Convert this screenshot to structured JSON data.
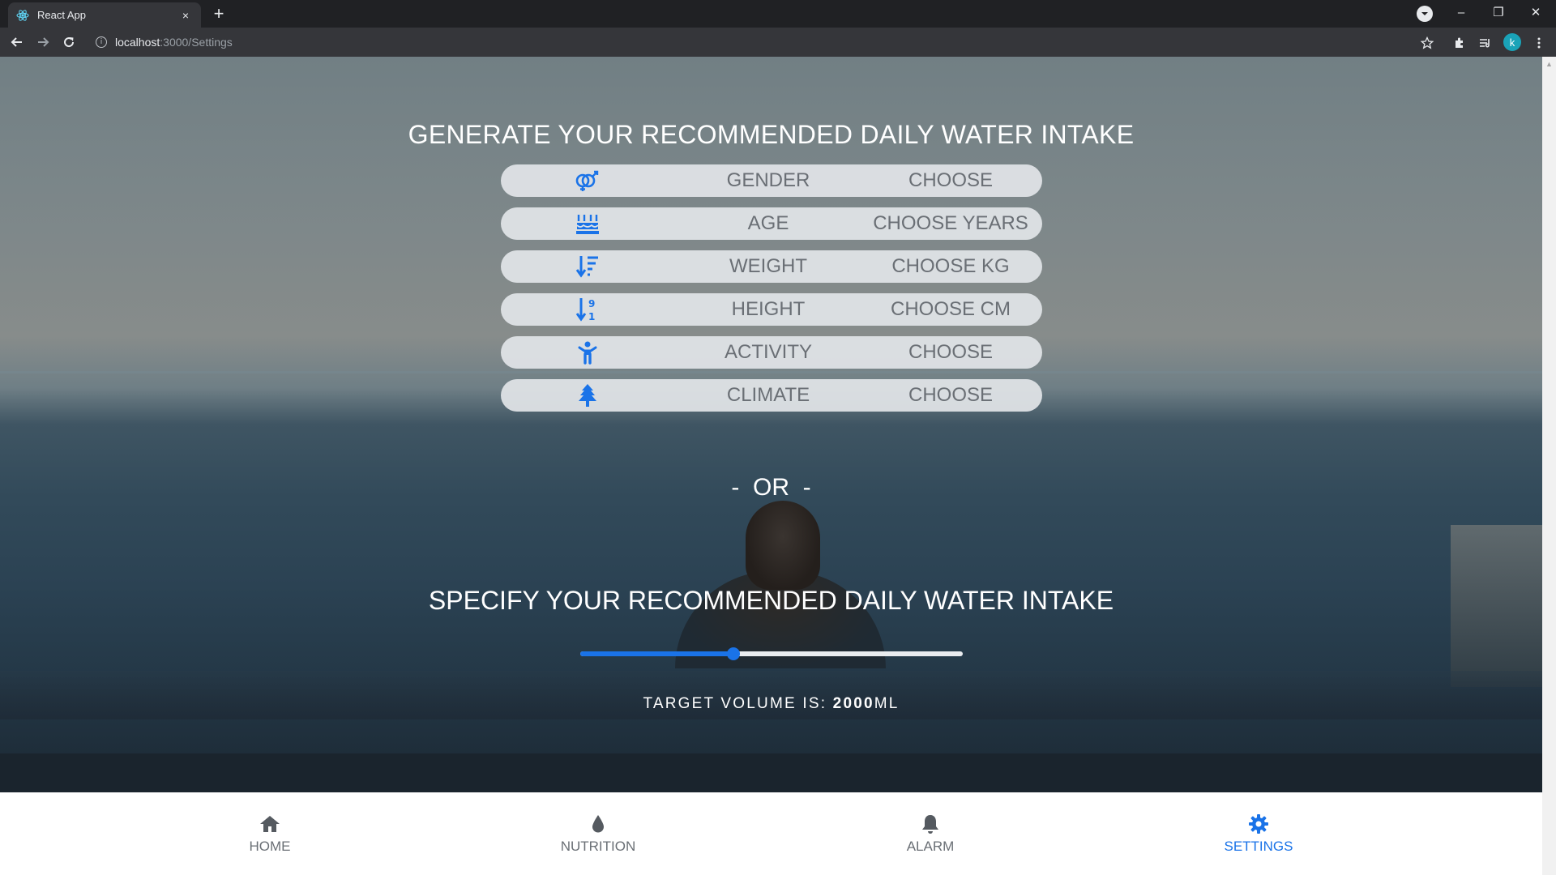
{
  "browser": {
    "tab_title": "React App",
    "tab_close": "×",
    "new_tab": "+",
    "url_host": "localhost",
    "url_path": ":3000/Settings",
    "profile_initial": "k",
    "window_controls": [
      "–",
      "❐",
      "✕"
    ]
  },
  "page": {
    "title": "GENERATE YOUR RECOMMENDED DAILY WATER INTAKE",
    "options": [
      {
        "icon": "gender-icon",
        "label": "GENDER",
        "value": "CHOOSE"
      },
      {
        "icon": "birthday-cake-icon",
        "label": "AGE",
        "value": "CHOOSE YEARS"
      },
      {
        "icon": "sort-amount-down-icon",
        "label": "WEIGHT",
        "value": "CHOOSE KG"
      },
      {
        "icon": "sort-numeric-down-icon",
        "label": "HEIGHT",
        "value": "CHOOSE CM"
      },
      {
        "icon": "child-icon",
        "label": "ACTIVITY",
        "value": "CHOOSE"
      },
      {
        "icon": "tree-icon",
        "label": "CLIMATE",
        "value": "CHOOSE"
      }
    ],
    "or_text": "-  OR  -",
    "specify_title": "SPECIFY YOUR RECOMMENDED DAILY WATER INTAKE",
    "slider": {
      "fraction": 0.4
    },
    "target_prefix": "TARGET VOLUME IS: ",
    "target_value": "2000",
    "target_unit": "ML"
  },
  "nav": {
    "items": [
      {
        "icon": "home-icon",
        "label": "HOME",
        "active": false
      },
      {
        "icon": "water-drop-icon",
        "label": "NUTRITION",
        "active": false
      },
      {
        "icon": "bell-icon",
        "label": "ALARM",
        "active": false
      },
      {
        "icon": "gear-icon",
        "label": "SETTINGS",
        "active": true
      }
    ]
  },
  "colors": {
    "accent": "#1a73e8",
    "row_bg": "#e1e4e7",
    "row_text": "#6a6f75"
  }
}
